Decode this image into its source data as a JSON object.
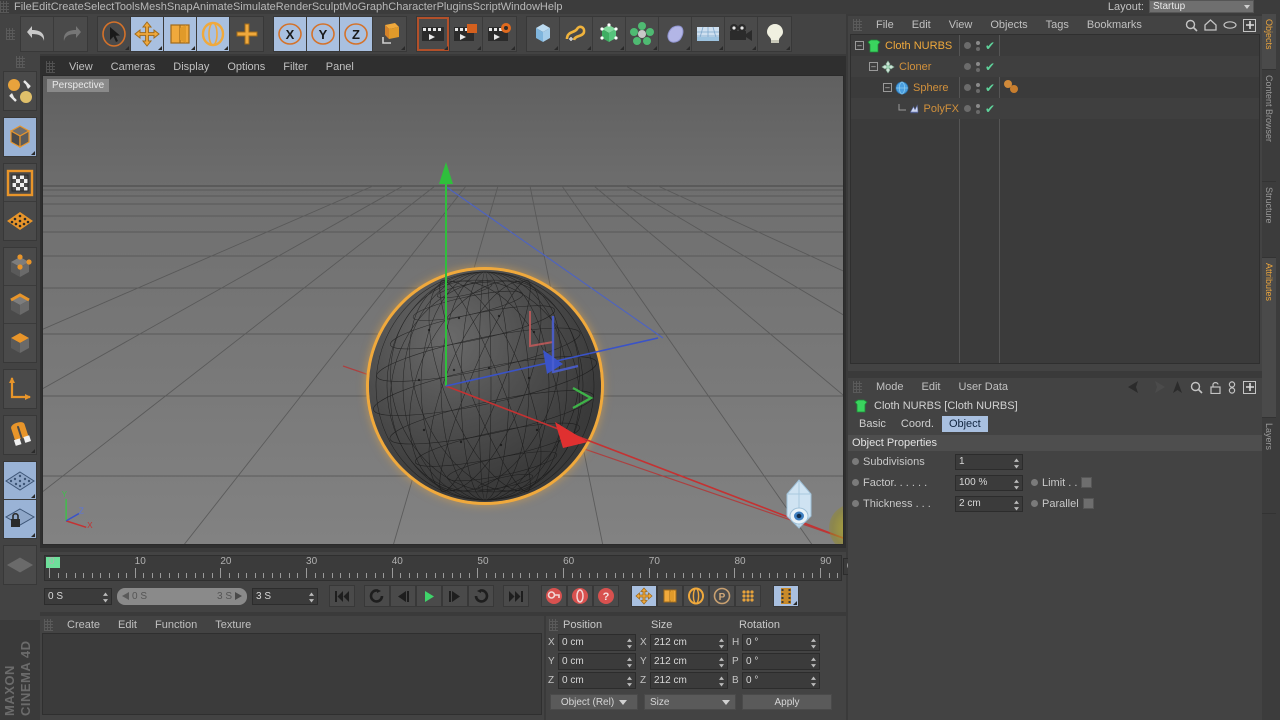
{
  "app": {
    "brand_company": "MAXON",
    "brand_product": "CINEMA 4D"
  },
  "main_menu": {
    "items": [
      "File",
      "Edit",
      "Create",
      "Select",
      "Tools",
      "Mesh",
      "Snap",
      "Animate",
      "Simulate",
      "Render",
      "Sculpt",
      "MoGraph",
      "Character",
      "Plugins",
      "Script",
      "Window",
      "Help"
    ]
  },
  "layout": {
    "label": "Layout:",
    "value": "Startup"
  },
  "toolbar": {
    "groups": [
      {
        "name": "history",
        "buttons": [
          {
            "name": "undo-button",
            "icon": "undo-icon",
            "state": "normal"
          },
          {
            "name": "redo-button",
            "icon": "redo-icon",
            "state": "disabled"
          }
        ]
      },
      {
        "name": "transform-tools",
        "buttons": [
          {
            "name": "select-tool-button",
            "icon": "arrow-select-icon",
            "state": "normal"
          },
          {
            "name": "move-tool-button",
            "icon": "move-icon",
            "state": "selected"
          },
          {
            "name": "scale-tool-button",
            "icon": "scale-icon",
            "state": "selected"
          },
          {
            "name": "rotate-tool-button",
            "icon": "rotate-icon",
            "state": "selected"
          },
          {
            "name": "add-tool-button",
            "icon": "plus-icon",
            "state": "normal"
          }
        ]
      },
      {
        "name": "axis-locks",
        "buttons": [
          {
            "name": "lock-x-button",
            "icon": "x-axis-icon",
            "state": "selected"
          },
          {
            "name": "lock-y-button",
            "icon": "y-axis-icon",
            "state": "selected"
          },
          {
            "name": "lock-z-button",
            "icon": "z-axis-icon",
            "state": "selected"
          },
          {
            "name": "world-coords-button",
            "icon": "world-axis-icon",
            "state": "normal"
          }
        ]
      },
      {
        "name": "render-tools",
        "buttons": [
          {
            "name": "render-view-button",
            "icon": "clapperboard-icon",
            "state": "active-frame"
          },
          {
            "name": "render-region-button",
            "icon": "clapperboard-region-icon",
            "state": "normal"
          },
          {
            "name": "render-settings-button",
            "icon": "clapperboard-gear-icon",
            "state": "normal"
          }
        ]
      },
      {
        "name": "create-objects",
        "buttons": [
          {
            "name": "add-cube-button",
            "icon": "cube-icon",
            "state": "normal"
          },
          {
            "name": "add-spline-button",
            "icon": "spline-icon",
            "state": "normal"
          },
          {
            "name": "add-generator-button",
            "icon": "generator-icon",
            "state": "normal"
          },
          {
            "name": "add-deformer-button",
            "icon": "deformer-icon",
            "state": "normal"
          },
          {
            "name": "add-environment-button",
            "icon": "environment-icon",
            "state": "normal"
          },
          {
            "name": "add-floor-button",
            "icon": "floor-grid-icon",
            "state": "normal"
          },
          {
            "name": "add-camera-button",
            "icon": "camera-icon",
            "state": "normal"
          },
          {
            "name": "add-light-button",
            "icon": "lightbulb-icon",
            "state": "normal"
          }
        ]
      }
    ]
  },
  "left_toolbar": {
    "buttons": [
      {
        "name": "texture-model-mode-button",
        "icon": "model-texture-toggle-icon",
        "state": "normal"
      },
      {
        "name": "model-mode-button",
        "icon": "model-cube-icon",
        "state": "selected"
      },
      {
        "name": "texture-mode-button",
        "icon": "texture-checker-icon",
        "state": "normal"
      },
      {
        "name": "points-mode-button",
        "icon": "points-grid-icon",
        "state": "normal"
      },
      {
        "name": "point-mode-button",
        "icon": "point-cube-icon",
        "state": "normal"
      },
      {
        "name": "edge-mode-button",
        "icon": "edge-cube-icon",
        "state": "normal"
      },
      {
        "name": "polygon-mode-button",
        "icon": "polygon-cube-icon",
        "state": "normal"
      },
      {
        "name": "axis-mode-button",
        "icon": "axis-corner-icon",
        "state": "normal"
      },
      {
        "name": "snap-magnet-button",
        "icon": "magnet-icon",
        "state": "normal"
      },
      {
        "name": "workplane-button",
        "icon": "workplane-grid-icon",
        "state": "selected"
      },
      {
        "name": "workplane-lock-button",
        "icon": "workplane-lock-icon",
        "state": "normal"
      }
    ]
  },
  "viewport": {
    "menu": [
      "View",
      "Cameras",
      "Display",
      "Options",
      "Filter",
      "Panel"
    ],
    "label": "Perspective",
    "axis_labels": {
      "x": "X",
      "y": "Y",
      "z": "Z"
    },
    "colors": {
      "x_axis": "#d03a3a",
      "y_axis": "#3fc04a",
      "z_axis": "#3a5bd0",
      "selection_outline": "#f0a93c"
    }
  },
  "timeline": {
    "ticks": [
      "0",
      "10",
      "20",
      "30",
      "40",
      "50",
      "60",
      "70",
      "80",
      "90"
    ],
    "current_time": "0 S",
    "range_start": "0 S",
    "range_end": "3 S",
    "end_time": "3 S",
    "preview_time": "0 S",
    "buttons": [
      {
        "name": "go-to-start-button",
        "icon": "skip-start-icon"
      },
      {
        "name": "play-backwards-loop-button",
        "icon": "loop-icon"
      },
      {
        "name": "step-back-button",
        "icon": "step-back-icon"
      },
      {
        "name": "play-button",
        "icon": "play-icon"
      },
      {
        "name": "step-forward-button",
        "icon": "step-forward-icon"
      },
      {
        "name": "loop-playback-button",
        "icon": "loop-back-icon"
      },
      {
        "name": "go-to-end-button",
        "icon": "skip-end-icon"
      },
      {
        "name": "record-keyframe-button",
        "icon": "record-key-icon"
      },
      {
        "name": "autokey-button",
        "icon": "autokey-icon"
      },
      {
        "name": "keyframe-selection-button",
        "icon": "question-key-icon"
      },
      {
        "name": "record-position-button",
        "icon": "move-key-icon"
      },
      {
        "name": "record-scale-button",
        "icon": "scale-key-icon"
      },
      {
        "name": "record-rotation-button",
        "icon": "rotate-key-icon"
      },
      {
        "name": "record-parameter-button",
        "icon": "parameter-key-icon"
      },
      {
        "name": "record-pla-button",
        "icon": "pla-dots-icon"
      },
      {
        "name": "keyframe-mode-button",
        "icon": "filmstrip-icon"
      }
    ]
  },
  "material_manager": {
    "menu": [
      "Create",
      "Edit",
      "Function",
      "Texture"
    ]
  },
  "coordinates": {
    "headers": [
      "Position",
      "Size",
      "Rotation"
    ],
    "rows": [
      {
        "pos_label": "X",
        "pos_value": "0 cm",
        "size_label": "X",
        "size_value": "212 cm",
        "rot_label": "H",
        "rot_value": "0 °"
      },
      {
        "pos_label": "Y",
        "pos_value": "0 cm",
        "size_label": "Y",
        "size_value": "212 cm",
        "rot_label": "P",
        "rot_value": "0 °"
      },
      {
        "pos_label": "Z",
        "pos_value": "0 cm",
        "size_label": "Z",
        "size_value": "212 cm",
        "rot_label": "B",
        "rot_value": "0 °"
      }
    ],
    "mode_dropdown": "Object (Rel)",
    "size_dropdown": "Size",
    "apply_button": "Apply"
  },
  "object_manager": {
    "menu": [
      "File",
      "Edit",
      "View",
      "Objects",
      "Tags",
      "Bookmarks"
    ],
    "header_icons": [
      "search-icon",
      "home-icon",
      "eye-icon",
      "add-icon"
    ],
    "objects": [
      {
        "name": "Cloth NURBS",
        "icon": "cloth-nurbs-icon",
        "depth": 0,
        "selected": true,
        "tags": 0
      },
      {
        "name": "Cloner",
        "icon": "cloner-icon",
        "depth": 1,
        "selected": false,
        "tags": 0
      },
      {
        "name": "Sphere",
        "icon": "sphere-icon",
        "depth": 2,
        "selected": false,
        "tags": 2
      },
      {
        "name": "PolyFX",
        "icon": "polyfx-icon",
        "depth": 3,
        "selected": false,
        "tags": 0
      }
    ]
  },
  "attribute_manager": {
    "menu": [
      "Mode",
      "Edit",
      "User Data"
    ],
    "header_icons": [
      "back-arrow-icon",
      "forward-arrow-icon",
      "up-arrow-icon",
      "search-icon",
      "lock-icon",
      "link-icon",
      "add-icon"
    ],
    "object_title": "Cloth NURBS [Cloth NURBS]",
    "object_icon": "cloth-nurbs-icon",
    "tabs": [
      {
        "label": "Basic",
        "selected": false
      },
      {
        "label": "Coord.",
        "selected": false
      },
      {
        "label": "Object",
        "selected": true
      }
    ],
    "section_title": "Object Properties",
    "properties": [
      {
        "label": "Subdivisions",
        "value": "1",
        "type": "number"
      },
      {
        "label": "Factor. . . . . .",
        "value": "100 %",
        "type": "number",
        "extra_label": "Limit . .",
        "extra_type": "checkbox"
      },
      {
        "label": "Thickness . . .",
        "value": "2 cm",
        "type": "number",
        "extra_label": "Parallel",
        "extra_type": "checkbox"
      }
    ]
  },
  "side_tabs": [
    {
      "label": "Objects",
      "selected": true
    },
    {
      "label": "Content Browser",
      "selected": false
    },
    {
      "label": "Structure",
      "selected": false
    },
    {
      "label": "Attributes",
      "selected": true
    },
    {
      "label": "Layers",
      "selected": false
    }
  ]
}
